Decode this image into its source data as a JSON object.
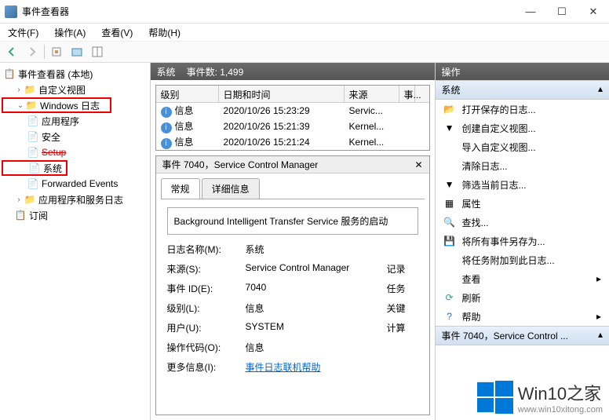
{
  "window": {
    "title": "事件查看器"
  },
  "menu": {
    "file": "文件(F)",
    "action": "操作(A)",
    "view": "查看(V)",
    "help": "帮助(H)"
  },
  "tree": {
    "root": "事件查看器 (本地)",
    "custom_views": "自定义视图",
    "windows_logs": "Windows 日志",
    "application": "应用程序",
    "security": "安全",
    "setup": "Setup",
    "system": "系统",
    "forwarded": "Forwarded Events",
    "app_service_logs": "应用程序和服务日志",
    "subscriptions": "订阅"
  },
  "center": {
    "title": "系统",
    "count_label": "事件数: 1,499",
    "cols": {
      "level": "级别",
      "datetime": "日期和时间",
      "source": "来源",
      "eventid": "事..."
    },
    "rows": [
      {
        "level": "信息",
        "dt": "2020/10/26 15:23:29",
        "src": "Servic..."
      },
      {
        "level": "信息",
        "dt": "2020/10/26 15:21:39",
        "src": "Kernel..."
      },
      {
        "level": "信息",
        "dt": "2020/10/26 15:21:24",
        "src": "Kernel..."
      }
    ]
  },
  "detail": {
    "header": "事件 7040，Service Control Manager",
    "tab_general": "常规",
    "tab_details": "详细信息",
    "message": "Background Intelligent Transfer Service 服务的启动",
    "props": {
      "log_name_label": "日志名称(M):",
      "log_name": "系统",
      "source_label": "来源(S):",
      "source": "Service Control Manager",
      "source_r": "记录",
      "eventid_label": "事件 ID(E):",
      "eventid": "7040",
      "eventid_r": "任务",
      "level_label": "级别(L):",
      "level": "信息",
      "level_r": "关键",
      "user_label": "用户(U):",
      "user": "SYSTEM",
      "user_r": "计算",
      "opcode_label": "操作代码(O):",
      "opcode": "信息",
      "more_label": "更多信息(I):",
      "more_link": "事件日志联机帮助"
    }
  },
  "actions": {
    "header": "操作",
    "group1": "系统",
    "items1": {
      "open_saved": "打开保存的日志...",
      "create_view": "创建自定义视图...",
      "import_view": "导入自定义视图...",
      "clear_log": "清除日志...",
      "filter": "筛选当前日志...",
      "props": "属性",
      "find": "查找...",
      "save_as": "将所有事件另存为...",
      "attach_task": "将任务附加到此日志...",
      "view": "查看",
      "refresh": "刷新",
      "help": "帮助"
    },
    "group2": "事件 7040，Service Control ..."
  },
  "watermark": {
    "text": "Win10之家",
    "url": "www.win10xitong.com"
  }
}
